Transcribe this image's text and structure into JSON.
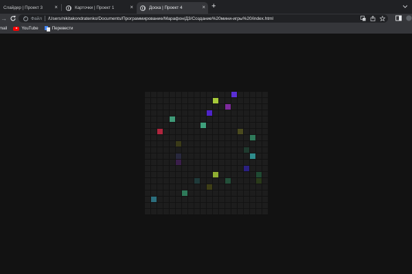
{
  "browser": {
    "tabs": [
      {
        "title": "Слайдер | Проект 3",
        "active": false
      },
      {
        "title": "Карточки | Проект 1",
        "active": false
      },
      {
        "title": "Доска | Проект 4",
        "active": true
      }
    ],
    "address_bar": {
      "file_label": "Файл",
      "url": "/Users/nikitakondratenko/Documents/Программирование/Марафон/Д3/Создание%20мини-игры%20/index.html"
    },
    "bookmarks": [
      {
        "label": "mail",
        "icon": "gmail-icon"
      },
      {
        "label": "YouTube",
        "icon": "youtube-icon"
      },
      {
        "label": "Перевести",
        "icon": "translate-icon"
      }
    ]
  },
  "board": {
    "rows": 20,
    "columns": 20,
    "cell_color": "#1d1d1d",
    "lit_cells": [
      {
        "row": 0,
        "col": 14,
        "color": "#5b2fd6"
      },
      {
        "row": 1,
        "col": 11,
        "color": "#a6c93a"
      },
      {
        "row": 2,
        "col": 13,
        "color": "#7e2a9c"
      },
      {
        "row": 3,
        "col": 10,
        "color": "#4e24c9"
      },
      {
        "row": 4,
        "col": 4,
        "color": "#3f9a78"
      },
      {
        "row": 5,
        "col": 9,
        "color": "#3fa07c"
      },
      {
        "row": 6,
        "col": 2,
        "color": "#b0253e"
      },
      {
        "row": 6,
        "col": 15,
        "color": "#4a4a1e"
      },
      {
        "row": 7,
        "col": 17,
        "color": "#2f7a5a"
      },
      {
        "row": 8,
        "col": 5,
        "color": "#3a3a18"
      },
      {
        "row": 9,
        "col": 16,
        "color": "#1f3a2e"
      },
      {
        "row": 10,
        "col": 5,
        "color": "#28283e"
      },
      {
        "row": 10,
        "col": 17,
        "color": "#2f8c8c"
      },
      {
        "row": 11,
        "col": 5,
        "color": "#3a1e4a"
      },
      {
        "row": 12,
        "col": 16,
        "color": "#2a2080"
      },
      {
        "row": 13,
        "col": 11,
        "color": "#8fae32"
      },
      {
        "row": 13,
        "col": 18,
        "color": "#1f4a33"
      },
      {
        "row": 14,
        "col": 8,
        "color": "#1f3a3a"
      },
      {
        "row": 14,
        "col": 13,
        "color": "#23503a"
      },
      {
        "row": 14,
        "col": 18,
        "color": "#2a3a1a"
      },
      {
        "row": 15,
        "col": 10,
        "color": "#3e3e16"
      },
      {
        "row": 16,
        "col": 6,
        "color": "#2f7a5a"
      },
      {
        "row": 17,
        "col": 1,
        "color": "#2c6f7e"
      }
    ]
  }
}
